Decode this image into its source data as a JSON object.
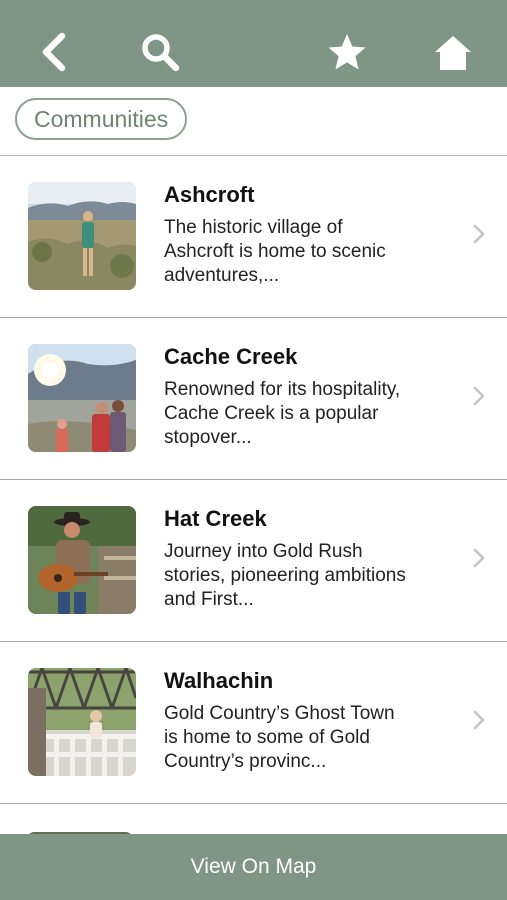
{
  "header": {
    "back_icon": "back-arrow-icon",
    "search_icon": "search-icon",
    "favorite_icon": "star-icon",
    "home_icon": "home-icon",
    "bar_color": "#7f9585"
  },
  "filter": {
    "chip_label": "Communities"
  },
  "communities": [
    {
      "title": "Ashcroft",
      "description": "The historic village of Ashcroft is home to scenic adventures,..."
    },
    {
      "title": "Cache Creek",
      "description": "Renowned for its hospitality, Cache Creek is a popular stopover..."
    },
    {
      "title": "Hat Creek",
      "description": "Journey into Gold Rush stories, pioneering ambitions and First..."
    },
    {
      "title": "Walhachin",
      "description": "Gold Country’s Ghost Town is home to some of Gold Country’s provinc..."
    }
  ],
  "footer": {
    "map_button_label": "View On Map"
  }
}
